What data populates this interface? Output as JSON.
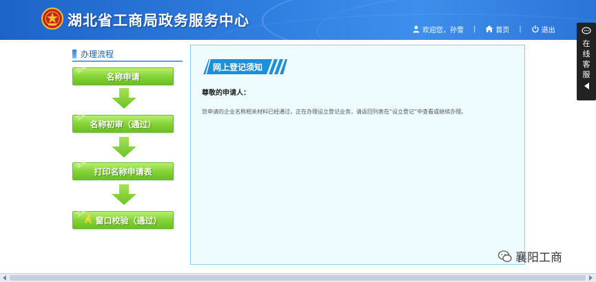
{
  "header": {
    "title": "湖北省工商局政务服务中心",
    "user_greeting": "欢迎您，孙雪",
    "home_label": "首页",
    "logout_label": "退出",
    "separator": "|"
  },
  "sidebar": {
    "heading": "办理流程",
    "steps": [
      {
        "tag": "企业",
        "label": "名称申请"
      },
      {
        "tag": "工商",
        "label": "名称初审（通过）"
      },
      {
        "tag": "企业",
        "label": "打印名称申请表"
      },
      {
        "tag": "工商",
        "label": "窗口校验（通过）"
      }
    ]
  },
  "main": {
    "banner": "网上登记须知",
    "greeting": "尊敬的申请人：",
    "message": "您申请的企业名称相关材料已经通过，正在办理设立登记业务，请返回列表在“设立登记”中查看或继续办理。"
  },
  "float_service": {
    "label": [
      "在",
      "线",
      "客",
      "服"
    ]
  },
  "watermark": {
    "text": "襄阳工商"
  },
  "colors": {
    "header_blue": "#2f7fe0",
    "step_green": "#86d33a",
    "panel_border": "#8ccbef",
    "banner_blue": "#1f8fd8"
  },
  "icons": {
    "user": "user-icon",
    "home": "home-icon",
    "logout": "power-icon",
    "emblem": "national-emblem-icon",
    "arrow": "arrow-down-icon",
    "chat": "chat-icon"
  }
}
